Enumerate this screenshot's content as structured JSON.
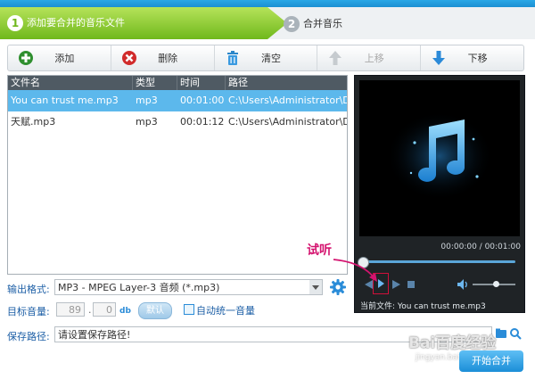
{
  "steps": [
    {
      "num": "1",
      "label": "添加要合并的音乐文件"
    },
    {
      "num": "2",
      "label": "合并音乐"
    }
  ],
  "toolbar": [
    {
      "label": "添加",
      "icon": "add-icon",
      "enabled": true
    },
    {
      "label": "删除",
      "icon": "delete-icon",
      "enabled": true
    },
    {
      "label": "清空",
      "icon": "trash-icon",
      "enabled": true
    },
    {
      "label": "上移",
      "icon": "arrow-up-icon",
      "enabled": false
    },
    {
      "label": "下移",
      "icon": "arrow-down-icon",
      "enabled": true
    }
  ],
  "filelist": {
    "columns": [
      "文件名",
      "类型",
      "时间",
      "路径"
    ],
    "rows": [
      {
        "name": "You can trust me.mp3",
        "type": "mp3",
        "time": "00:01:00",
        "path": "C:\\Users\\Administrator\\D...",
        "selected": true
      },
      {
        "name": "天赋.mp3",
        "type": "mp3",
        "time": "00:01:12",
        "path": "C:\\Users\\Administrator\\D...",
        "selected": false
      }
    ]
  },
  "player": {
    "time": "00:00:00 / 00:01:00",
    "progress": 0,
    "volume": 0.55,
    "current_file": "当前文件: You can trust me.mp3",
    "annotation": "试听"
  },
  "form": {
    "format_label": "输出格式:",
    "format_value": "MP3 - MPEG Layer-3 音频 (*.mp3)",
    "volume_label": "目标音量:",
    "volume_int": "89",
    "volume_dec": "0",
    "volume_unit": "db",
    "default_button": "默认",
    "unify_label": "自动统一音量",
    "save_label": "保存路径:",
    "save_value": "请设置保存路径!",
    "start_button": "开始合并"
  },
  "watermark": {
    "line1": "Bai百度经验",
    "line2": "jingyan.baidu.com"
  },
  "colors": {
    "accent": "#1b8ed7",
    "step_active": "#8fd232",
    "selected_row": "#5cb8ec",
    "annotation": "#d4136f"
  }
}
